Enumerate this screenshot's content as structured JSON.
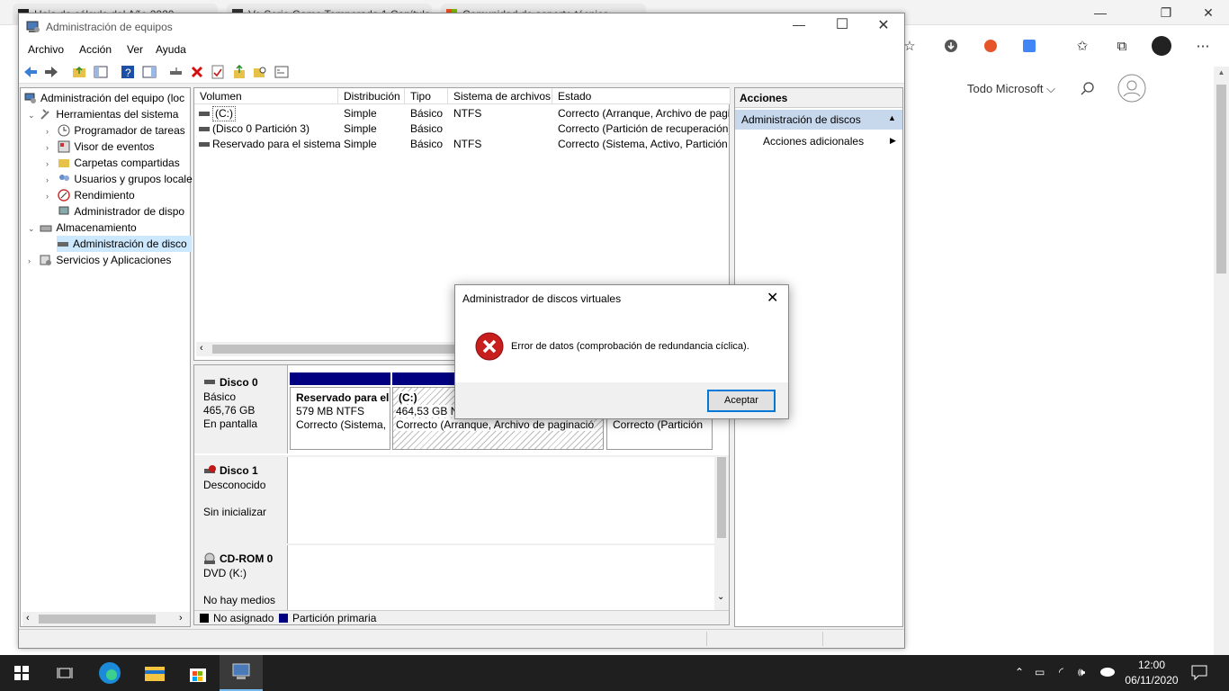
{
  "browser": {
    "tabs": [
      "Hoja de cálculo del Año 2020...",
      "Ve Serie Game Temporada 1 Capítulo",
      "Comunidad de soporte técnico"
    ],
    "search_label": "Todo Microsoft"
  },
  "window": {
    "title": "Administración de equipos",
    "menu": [
      "Archivo",
      "Acción",
      "Ver",
      "Ayuda"
    ]
  },
  "tree": {
    "root": "Administración del equipo (loc",
    "items": [
      {
        "label": "Herramientas del sistema",
        "level": 1,
        "expanded": true
      },
      {
        "label": "Programador de tareas",
        "level": 2
      },
      {
        "label": "Visor de eventos",
        "level": 2
      },
      {
        "label": "Carpetas compartidas",
        "level": 2
      },
      {
        "label": "Usuarios y grupos locale",
        "level": 2
      },
      {
        "label": "Rendimiento",
        "level": 2
      },
      {
        "label": "Administrador de dispo",
        "level": 2
      },
      {
        "label": "Almacenamiento",
        "level": 1,
        "expanded": true
      },
      {
        "label": "Administración de disco",
        "level": 2,
        "selected": true
      },
      {
        "label": "Servicios y Aplicaciones",
        "level": 1
      }
    ]
  },
  "volumes": {
    "headers": [
      "Volumen",
      "Distribución",
      "Tipo",
      "Sistema de archivos",
      "Estado"
    ],
    "rows": [
      [
        "(C:)",
        "Simple",
        "Básico",
        "NTFS",
        "Correcto (Arranque, Archivo de pagi"
      ],
      [
        "(Disco 0 Partición 3)",
        "Simple",
        "Básico",
        "",
        "Correcto (Partición de recuperación)"
      ],
      [
        "Reservado para el sistema",
        "Simple",
        "Básico",
        "NTFS",
        "Correcto (Sistema, Activo, Partición"
      ]
    ]
  },
  "disks": {
    "disk0": {
      "name": "Disco 0",
      "type": "Básico",
      "size": "465,76 GB",
      "status": "En pantalla"
    },
    "disk0_parts": [
      {
        "title": "Reservado para el",
        "size": "579 MB NTFS",
        "status": "Correcto (Sistema,"
      },
      {
        "title": "(C:)",
        "size": "464,53 GB N",
        "status": "Correcto (Arranque, Archivo de paginació"
      },
      {
        "title": "",
        "size": "",
        "status": "Correcto (Partición"
      }
    ],
    "disk1": {
      "name": "Disco 1",
      "type": "Desconocido",
      "status": "Sin inicializar"
    },
    "cdrom": {
      "name": "CD-ROM 0",
      "type": "DVD (K:)",
      "status": "No hay medios"
    }
  },
  "legend": {
    "unallocated": "No asignado",
    "primary": "Partición primaria"
  },
  "actions": {
    "header": "Acciones",
    "section": "Administración de discos",
    "more": "Acciones adicionales"
  },
  "dialog": {
    "title": "Administrador de discos virtuales",
    "message": "Error de datos (comprobación de redundancia cíclica).",
    "ok": "Aceptar"
  },
  "clock": {
    "time": "12:00",
    "date": "06/11/2020"
  },
  "colors": {
    "primary_partition": "#000080",
    "unallocated": "#000000",
    "selection": "#cce8ff"
  }
}
